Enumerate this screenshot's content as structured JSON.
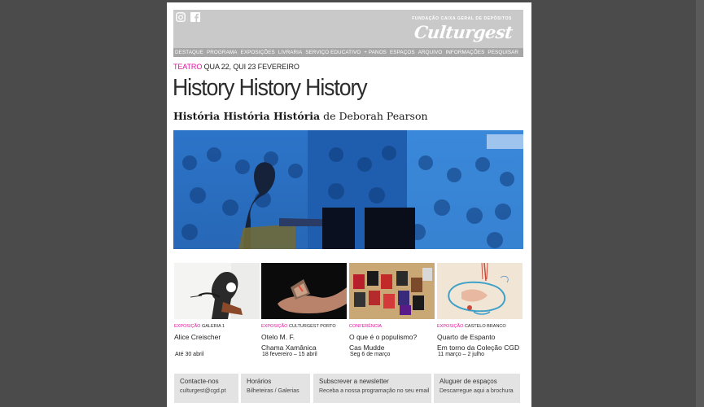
{
  "header": {
    "foundation": "FUNDAÇÃO CAIXA GERAL DE DEPÓSITOS",
    "logo": "Culturgest",
    "social": [
      "instagram-icon",
      "facebook-icon"
    ]
  },
  "nav": {
    "items": [
      "DESTAQUE",
      "PROGRAMA",
      "EXPOSIÇÕES",
      "LIVRARIA",
      "SERVIÇO EDUCATIVO",
      "+ PANOS",
      "ESPAÇOS",
      "ARQUIVO",
      "INFORMAÇÕES",
      "PESQUISAR"
    ]
  },
  "event": {
    "category": "TEATRO",
    "dates": "QUA 22, QUI 23 FEVEREIRO",
    "title": "History History History",
    "subtitle_bold": "História História História",
    "subtitle_rest": " de Deborah Pearson"
  },
  "cards": [
    {
      "category": "EXPOSIÇÃO",
      "venue": "GALERIA 1",
      "title1": "Alice Creischer",
      "title2": "",
      "date": "Até 30 abril"
    },
    {
      "category": "EXPOSIÇÃO",
      "venue": "CULTURGEST PORTO",
      "title1": "Otelo M. F.",
      "title2": "Chama Xamânica",
      "date": "18 fevereiro – 15 abril"
    },
    {
      "category": "CONFERÊNCIA",
      "venue": "",
      "title1": "O que é o populismo?",
      "title2": "Cas Mudde",
      "date": "Seg 6 de março"
    },
    {
      "category": "EXPOSIÇÃO",
      "venue": "CASTELO BRANCO",
      "title1": "Quarto de Espanto",
      "title2": "Em torno da Coleção CGD",
      "date": "11 março – 2 julho"
    }
  ],
  "footer": [
    {
      "title": "Contacte-nos",
      "text": "culturgest@cgd.pt"
    },
    {
      "title": "Horários",
      "text": "Bilheteiras / Galerias"
    },
    {
      "title": "Subscrever a newsletter",
      "text": "Receba a nossa programação no seu email"
    },
    {
      "title": "Aluguer de espaços",
      "text": "Descarregue aqui a brochura"
    }
  ],
  "colors": {
    "accent": "#e0119e",
    "header_bg": "#c9c9c9",
    "nav_bg": "#a6a6a6",
    "hero_blue": "#2f7fd0",
    "page_bg": "#4b4b4b"
  }
}
